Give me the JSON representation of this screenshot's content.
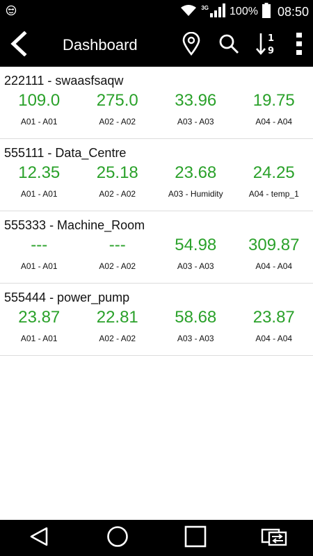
{
  "status_bar": {
    "network": "3G",
    "battery": "100%",
    "time": "08:50"
  },
  "app_bar": {
    "title": "Dashboard",
    "icons": [
      "back-icon",
      "location-pin-icon",
      "search-icon",
      "sort-numeric-icon",
      "overflow-menu-icon"
    ]
  },
  "devices": [
    {
      "title": "222111 - swaasfsaqw",
      "cells": [
        {
          "value": "109.0",
          "label": "A01 - A01"
        },
        {
          "value": "275.0",
          "label": "A02 - A02"
        },
        {
          "value": "33.96",
          "label": "A03 - A03"
        },
        {
          "value": "19.75",
          "label": "A04 - A04"
        }
      ]
    },
    {
      "title": "555111 - Data_Centre",
      "cells": [
        {
          "value": "12.35",
          "label": "A01 - A01"
        },
        {
          "value": "25.18",
          "label": "A02 - A02"
        },
        {
          "value": "23.68",
          "label": "A03 - Humidity"
        },
        {
          "value": "24.25",
          "label": "A04 - temp_1"
        }
      ]
    },
    {
      "title": "555333 - Machine_Room",
      "cells": [
        {
          "value": "---",
          "label": "A01 - A01"
        },
        {
          "value": "---",
          "label": "A02 - A02"
        },
        {
          "value": "54.98",
          "label": "A03 - A03"
        },
        {
          "value": "309.87",
          "label": "A04 - A04"
        }
      ]
    },
    {
      "title": "555444 - power_pump",
      "cells": [
        {
          "value": "23.87",
          "label": "A01 - A01"
        },
        {
          "value": "22.81",
          "label": "A02 - A02"
        },
        {
          "value": "58.68",
          "label": "A03 - A03"
        },
        {
          "value": "23.87",
          "label": "A04 - A04"
        }
      ]
    }
  ],
  "nav_bar": {
    "icons": [
      "back-triangle-icon",
      "home-circle-icon",
      "recents-square-icon",
      "dual-window-icon"
    ]
  },
  "colors": {
    "value_green": "#2aa12a",
    "bar_background": "#000000"
  }
}
